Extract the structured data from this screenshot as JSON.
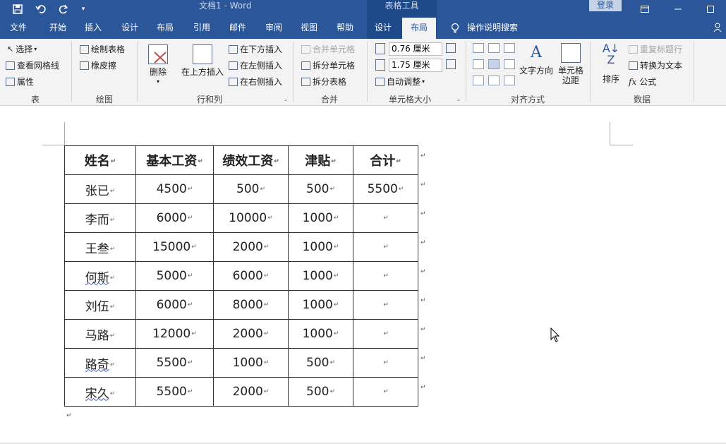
{
  "titlebar": {
    "title": "文档1  -  Word",
    "context_title": "表格工具",
    "login": "登录",
    "save_icon": "save-icon",
    "undo_icon": "undo-icon",
    "redo_icon": "redo-icon",
    "customize_icon": "customize-icon"
  },
  "tabs": [
    "文件",
    "开始",
    "插入",
    "设计",
    "布局",
    "引用",
    "邮件",
    "审阅",
    "视图",
    "帮助",
    "设计",
    "布局"
  ],
  "tellme": "操作说明搜索",
  "ribbon": {
    "table_group": {
      "label": "表",
      "select": "选择",
      "gridlines": "查看网格线",
      "properties": "属性"
    },
    "draw_group": {
      "label": "绘图",
      "draw_table": "绘制表格",
      "eraser": "橡皮擦"
    },
    "rows_cols_group": {
      "label": "行和列",
      "delete": "删除",
      "insert_above": "在上方插入",
      "insert_below": "在下方插入",
      "insert_left": "在左侧插入",
      "insert_right": "在右侧插入"
    },
    "merge_group": {
      "label": "合并",
      "merge_cells": "合并单元格",
      "split_cells": "拆分单元格",
      "split_table": "拆分表格"
    },
    "cell_size_group": {
      "label": "单元格大小",
      "height": "0.76 厘米",
      "width": "1.75 厘米",
      "autofit": "自动调整"
    },
    "alignment_group": {
      "label": "对齐方式",
      "text_direction": "文字方向",
      "cell_margins": "单元格\n边距"
    },
    "data_group": {
      "label": "数据",
      "sort": "排序",
      "repeat_header": "重复标题行",
      "convert_text": "转换为文本",
      "formula": "公式"
    }
  },
  "table": {
    "headers": [
      "姓名",
      "基本工资",
      "绩效工资",
      "津贴",
      "合计"
    ],
    "rows": [
      [
        "张已",
        "4500",
        "500",
        "500",
        "5500"
      ],
      [
        "李而",
        "6000",
        "10000",
        "1000",
        ""
      ],
      [
        "王叁",
        "15000",
        "2000",
        "1000",
        ""
      ],
      [
        "何斯",
        "5000",
        "6000",
        "1000",
        ""
      ],
      [
        "刘伍",
        "6000",
        "8000",
        "1000",
        ""
      ],
      [
        "马路",
        "12000",
        "2000",
        "1000",
        ""
      ],
      [
        "路奇",
        "5500",
        "1000",
        "500",
        ""
      ],
      [
        "宋久",
        "5500",
        "2000",
        "500",
        ""
      ]
    ],
    "mark": "↵"
  }
}
